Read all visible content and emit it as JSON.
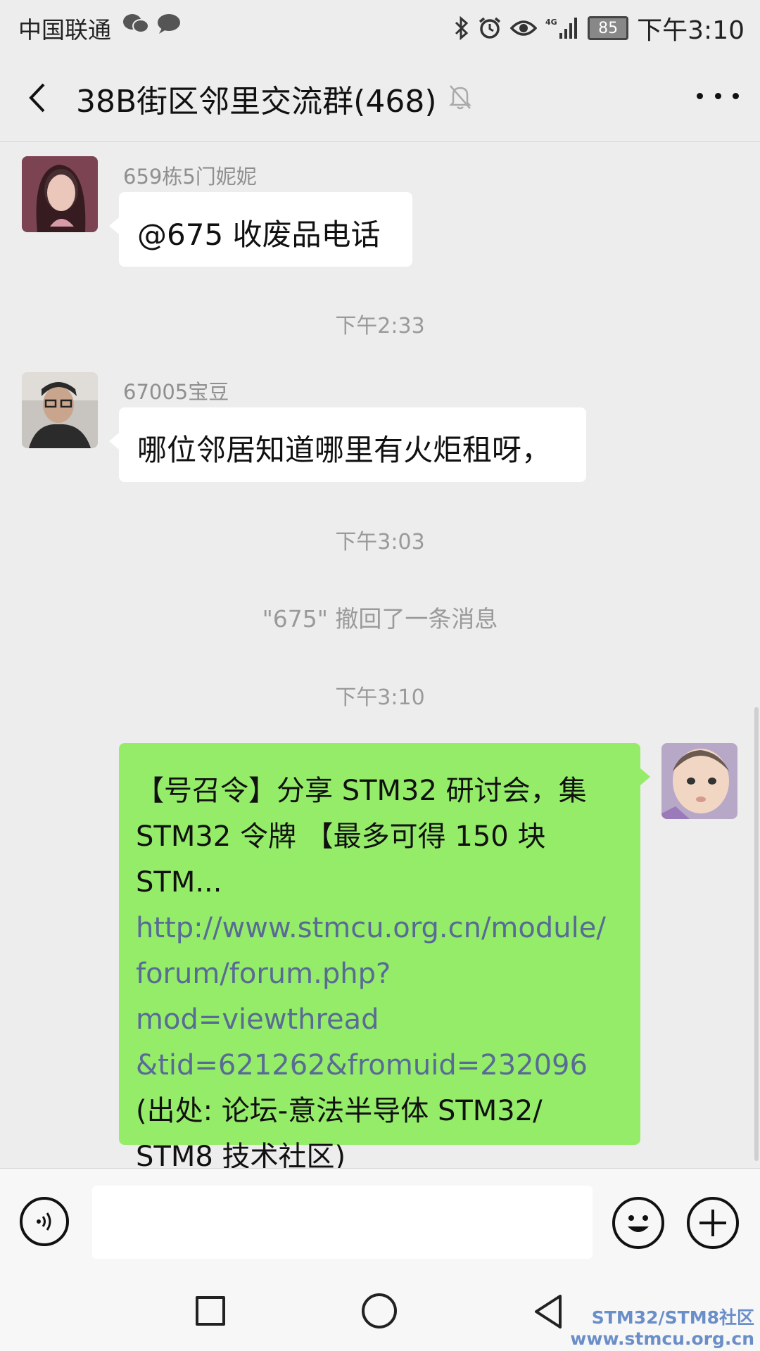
{
  "status_bar": {
    "carrier": "中国联通",
    "battery": "85",
    "time": "下午3:10"
  },
  "header": {
    "title": "38B街区邻里交流群(468)"
  },
  "messages": [
    {
      "sender": "659栋5门妮妮",
      "text": "@675  收废品电话"
    },
    {
      "timestamp": "下午2:33"
    },
    {
      "sender": "67005宝豆",
      "text": "哪位邻居知道哪里有火炬租呀，"
    },
    {
      "timestamp": "下午3:03"
    },
    {
      "system": "\"675\" 撤回了一条消息"
    },
    {
      "timestamp": "下午3:10"
    },
    {
      "mine": true,
      "line1": "【号召令】分享 STM32 研讨会，集",
      "line2": "STM32 令牌 【最多可得 150 块",
      "line3": "STM...",
      "link1": "http://www.stmcu.org.cn/module/",
      "link2": "forum/forum.php?mod=viewthread",
      "link3": "&tid=621262&fromuid=232096",
      "line4": "(出处: 论坛-意法半导体 STM32/",
      "line5": "STM8 技术社区)"
    }
  ],
  "input": {
    "value": ""
  },
  "watermark": {
    "line1": "STM32/STM8社区",
    "line2": "www.stmcu.org.cn"
  },
  "colors": {
    "background": "#ededed",
    "my_bubble": "#95ec69",
    "link": "#576b95",
    "watermark": "#6a8fc8"
  }
}
